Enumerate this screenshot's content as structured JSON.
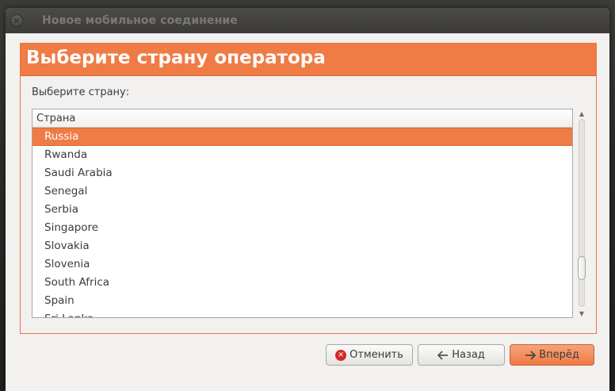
{
  "window": {
    "title": "Новое мобильное соединение"
  },
  "header": {
    "title": "Выберите страну оператора"
  },
  "prompt": {
    "label": "Выберите страну:"
  },
  "list": {
    "column_header": "Страна",
    "selected": "Russia",
    "items": [
      "Russia",
      "Rwanda",
      "Saudi Arabia",
      "Senegal",
      "Serbia",
      "Singapore",
      "Slovakia",
      "Slovenia",
      "South Africa",
      "Spain",
      "Sri Lanka"
    ]
  },
  "buttons": {
    "cancel_label": "Отменить",
    "back_label": "Назад",
    "forward_label": "Вперёд"
  },
  "colors": {
    "accent": "#ef7b45",
    "titlebar": "#3c3b37",
    "window_bg": "#f2f1f0"
  }
}
